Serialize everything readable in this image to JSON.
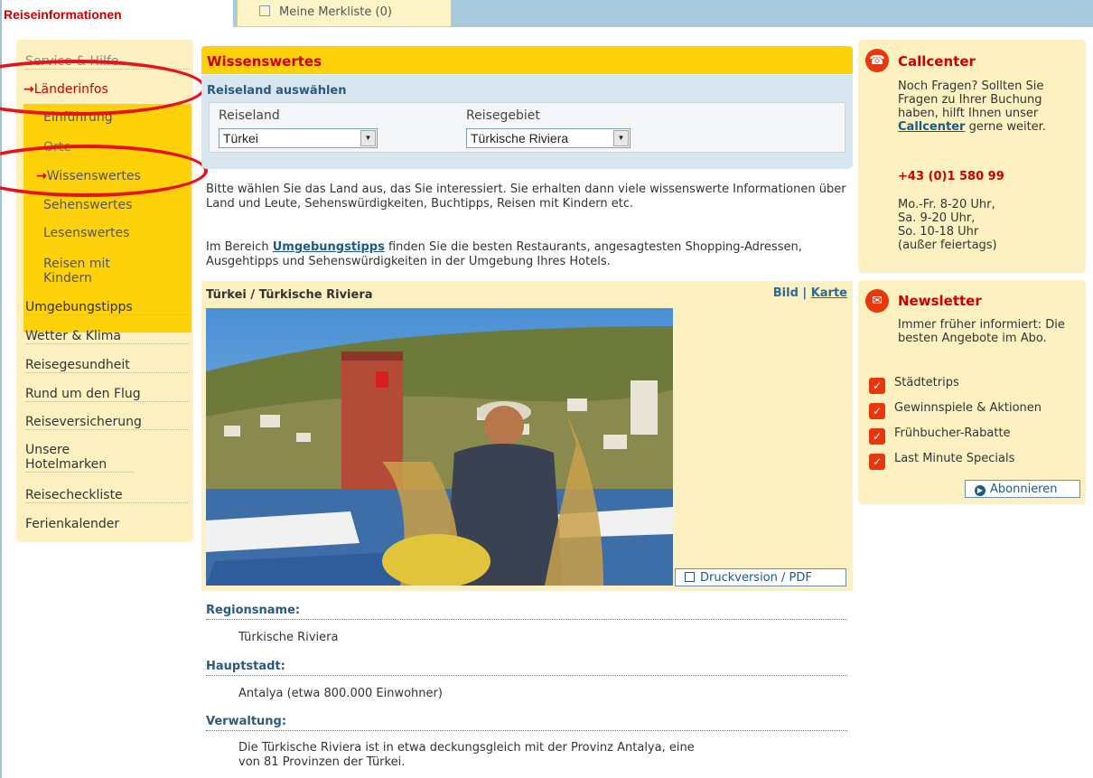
{
  "header": {
    "title": "Reiseinformationen",
    "merkliste": "Meine Merkliste (0)"
  },
  "sidebar": {
    "items": [
      {
        "label": "Service & Hilfe"
      },
      {
        "label": "Länderinfos"
      },
      {
        "label": "Umgebungstipps"
      },
      {
        "label": "Wetter & Klima"
      },
      {
        "label": "Reisegesundheit"
      },
      {
        "label": "Rund um den Flug"
      },
      {
        "label": "Reiseversicherung"
      },
      {
        "label": "Unsere Hotelmarken"
      },
      {
        "label": "Reisecheckliste"
      },
      {
        "label": "Ferienkalender"
      }
    ],
    "subitems": [
      {
        "label": "Einführung"
      },
      {
        "label": "Orte"
      },
      {
        "label": "Wissenswertes"
      },
      {
        "label": "Sehenswertes"
      },
      {
        "label": "Lesenswertes"
      },
      {
        "label": "Reisen mit Kindern"
      }
    ],
    "active_item": "Länderinfos",
    "active_subitem": "Wissenswertes"
  },
  "main": {
    "title": "Wissenswertes",
    "select_panel": {
      "title": "Reiseland auswählen",
      "country_label": "Reiseland",
      "country_value": "Türkei",
      "region_label": "Reisegebiet",
      "region_value": "Türkische Riviera"
    },
    "intro1": "Bitte wählen Sie das Land aus, das Sie interessiert. Sie erhalten dann viele wissenswerte Informationen über Land und Leute, Sehenswürdigkeiten, Buchtipps, Reisen mit Kindern etc.",
    "intro2_before": "Im Bereich ",
    "intro2_link": "Umgebungstipps",
    "intro2_after": " finden Sie die besten Restaurants, angesagtesten Shopping-Adressen, Ausgehtipps und Sehenswürdigkeiten in der Umgebung Ihres Hotels.",
    "image_panel": {
      "title": "Türkei / Türkische Riviera",
      "link_bild": "Bild",
      "separator": "|",
      "link_karte": "Karte",
      "print_label": "Druckversion / PDF"
    },
    "sections": [
      {
        "label": "Regionsname:",
        "text": "Türkische Riviera"
      },
      {
        "label": "Hauptstadt:",
        "text": "Antalya (etwa 800.000 Einwohner)"
      },
      {
        "label": "Verwaltung:",
        "text": "Die Türkische Riviera ist in etwa deckungsgleich mit der Provinz Antalya, eine von 81 Provinzen der Türkei."
      }
    ]
  },
  "callcenter": {
    "title": "Callcenter",
    "text_before": "Noch Fragen? Sollten Sie Fragen zu Ihrer Buchung haben, hilft Ihnen unser ",
    "link": "Callcenter",
    "text_after": " gerne weiter.",
    "phone": "+43 (0)1 580 99",
    "hours": [
      "Mo.-Fr. 8-20 Uhr,",
      "Sa. 9-20 Uhr,",
      "So. 10-18 Uhr",
      "(außer feiertags)"
    ]
  },
  "newsletter": {
    "title": "Newsletter",
    "text": "Immer früher informiert: Die besten Angebote im Abo.",
    "items": [
      "Städtetrips",
      "Gewinnspiele & Aktionen",
      "Frühbucher-Rabatte",
      "Last Minute Specials"
    ],
    "button": "Abonnieren"
  },
  "colors": {
    "accent_red": "#cc0000",
    "highlight_yellow": "#fdd20a",
    "panel_yellow": "#fdf1c2",
    "annotation_red": "#e8121b"
  }
}
